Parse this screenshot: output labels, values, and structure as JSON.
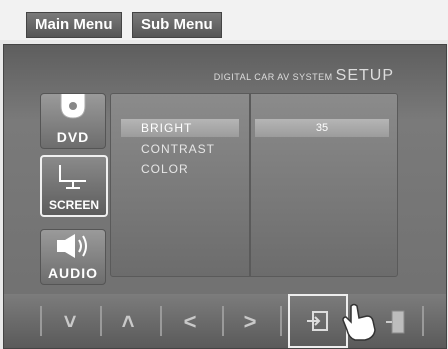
{
  "tags": {
    "main": "Main Menu",
    "sub": "Sub Menu"
  },
  "brand": {
    "system": "DIGITAL CAR AV SYSTEM",
    "setup": "SETUP"
  },
  "sources": [
    {
      "label": "DVD",
      "icon": "dvd-disc-icon"
    },
    {
      "label": "SCREEN",
      "icon": "monitor-icon",
      "selected": true
    },
    {
      "label": "AUDIO",
      "icon": "speaker-icon"
    }
  ],
  "menu": {
    "items": [
      "BRIGHT",
      "CONTRAST",
      "COLOR"
    ],
    "selected_value": "35"
  },
  "nav": {
    "down": "˅",
    "up": "˄",
    "left": "<",
    "right": ">",
    "enter_icon": "enter-icon",
    "exit_icon": "exit-icon"
  }
}
